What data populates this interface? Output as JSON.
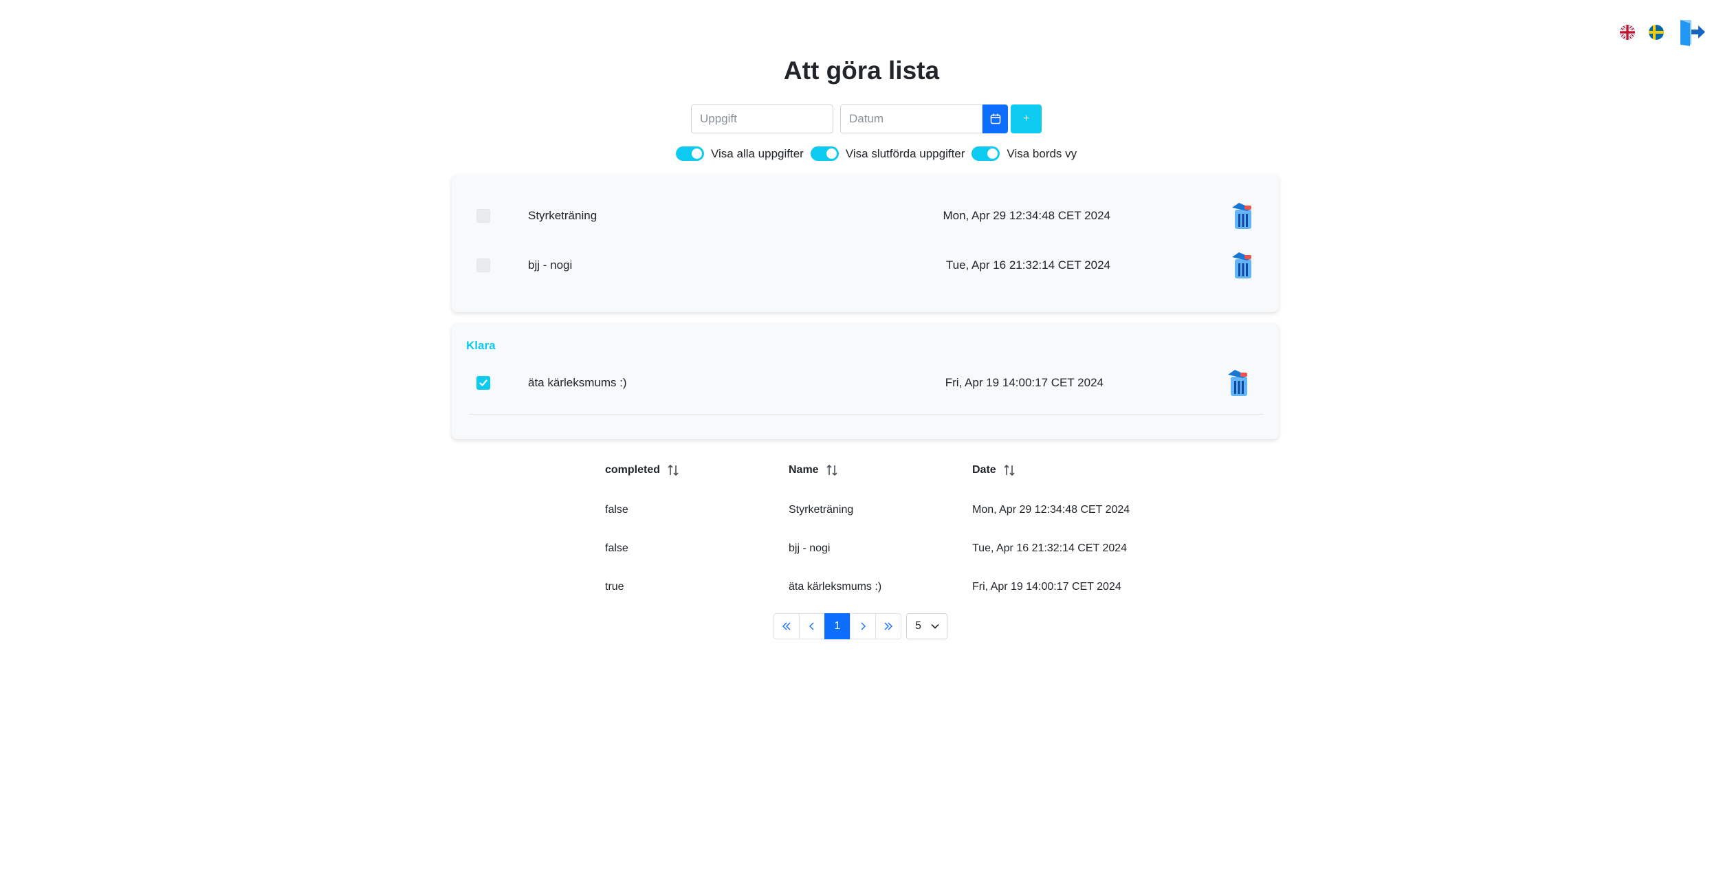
{
  "header": {
    "title": "Att göra lista",
    "icons": [
      "uk-flag-icon",
      "sweden-flag-icon",
      "logout-icon"
    ]
  },
  "form": {
    "task_placeholder": "Uppgift",
    "date_placeholder": "Datum",
    "calendar_icon": "calendar-icon",
    "add_label": "+"
  },
  "toggles": [
    {
      "label": "Visa alla uppgifter",
      "on": true
    },
    {
      "label": "Visa slutförda uppgifter",
      "on": true
    },
    {
      "label": "Visa bords vy",
      "on": true
    }
  ],
  "todo": [
    {
      "name": "Styrketräning",
      "date": "Mon, Apr 29 12:34:48 CET 2024",
      "completed": false
    },
    {
      "name": "bjj - nogi",
      "date": "Tue, Apr 16 21:32:14 CET 2024",
      "completed": false
    }
  ],
  "done": {
    "heading": "Klara",
    "items": [
      {
        "name": "äta kärleksmums :)",
        "date": "Fri, Apr 19 14:00:17 CET 2024",
        "completed": true
      }
    ]
  },
  "table": {
    "headers": [
      "completed",
      "Name",
      "Date"
    ],
    "rows": [
      [
        "false",
        "Styrketräning",
        "Mon, Apr 29 12:34:48 CET 2024"
      ],
      [
        "false",
        "bjj - nogi",
        "Tue, Apr 16 21:32:14 CET 2024"
      ],
      [
        "true",
        "äta kärleksmums :)",
        "Fri, Apr 19 14:00:17 CET 2024"
      ]
    ]
  },
  "pagination": {
    "current_page": "1",
    "page_size": "5"
  },
  "colors": {
    "primary": "#0d6efd",
    "info": "#0dcaf0",
    "card_bg": "#f8f9fa"
  }
}
